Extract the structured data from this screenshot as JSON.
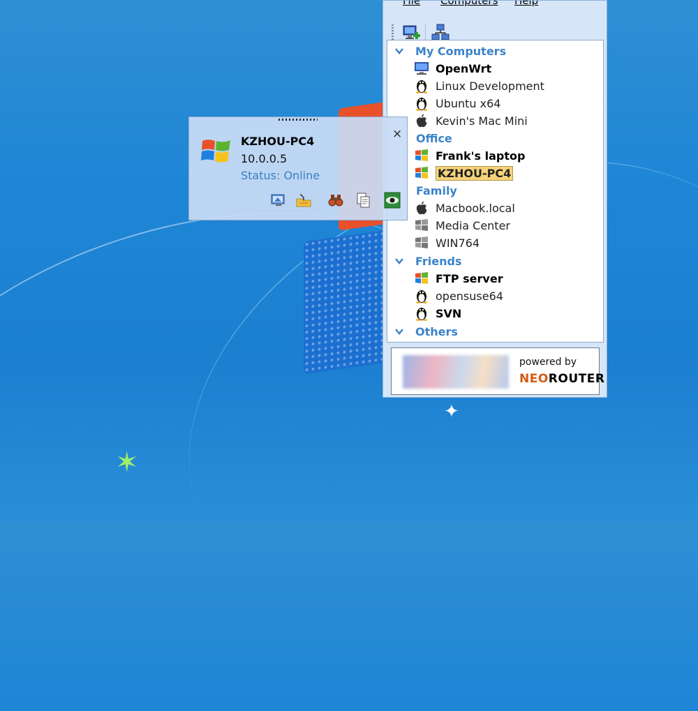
{
  "menu": {
    "file": "File",
    "computers": "Computers",
    "help": "Help"
  },
  "toolbar": {
    "add_icon": "add-computer-icon",
    "network_icon": "network-icon"
  },
  "tree": {
    "groups": [
      {
        "name": "My Computers",
        "items": [
          {
            "label": "OpenWrt",
            "icon": "monitor-icon",
            "bold": true
          },
          {
            "label": "Linux Development",
            "icon": "linux-icon",
            "bold": false
          },
          {
            "label": "Ubuntu x64",
            "icon": "linux-icon",
            "bold": false
          },
          {
            "label": "Kevin's Mac Mini",
            "icon": "apple-icon",
            "bold": false
          }
        ]
      },
      {
        "name": "Office",
        "items": [
          {
            "label": "Frank's laptop",
            "icon": "windows-icon",
            "bold": true
          },
          {
            "label": "KZHOU-PC4",
            "icon": "windows-icon",
            "bold": true,
            "selected": true
          }
        ]
      },
      {
        "name": "Family",
        "items": [
          {
            "label": "Macbook.local",
            "icon": "apple-icon",
            "bold": false
          },
          {
            "label": "Media Center",
            "icon": "windows-gray-icon",
            "bold": false
          },
          {
            "label": "WIN764",
            "icon": "windows-gray-icon",
            "bold": false
          }
        ]
      },
      {
        "name": "Friends",
        "items": [
          {
            "label": "FTP server",
            "icon": "windows-icon",
            "bold": true
          },
          {
            "label": "opensuse64",
            "icon": "linux-icon",
            "bold": false
          },
          {
            "label": "SVN",
            "icon": "linux-icon",
            "bold": true
          }
        ]
      },
      {
        "name": "Others",
        "items": []
      }
    ]
  },
  "powered": {
    "line1": "powered by",
    "brand_a": "NEO",
    "brand_b": "ROUTER"
  },
  "popup": {
    "name": "KZHOU-PC4",
    "ip": "10.0.0.5",
    "status": "Status: Online",
    "close": "×",
    "actions": [
      "remote-desktop-icon",
      "file-share-icon",
      "binoculars-icon",
      "copy-icon",
      "view-icon"
    ]
  },
  "colors": {
    "group": "#3b83c9",
    "selected": "#f6d37a",
    "desktop": "#1f86d6"
  }
}
